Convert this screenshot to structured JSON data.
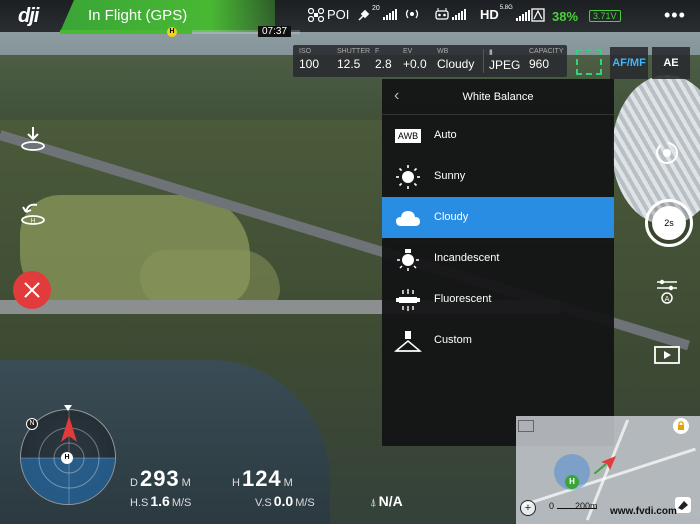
{
  "topbar": {
    "logo": "dji",
    "status": "In Flight (GPS)",
    "poi_label": "POI",
    "gps_count": "20",
    "hd_label": "HD",
    "hd_band": "5.8G",
    "battery_percent": "38%",
    "battery_voltage": "3.71V",
    "flight_time": "07:37",
    "home_marker": "H",
    "flight_progress": 0.55,
    "status_color": "#49b833"
  },
  "camera": {
    "params": [
      {
        "label": "ISO",
        "value": "100"
      },
      {
        "label": "SHUTTER",
        "value": "12.5"
      },
      {
        "label": "F",
        "value": "2.8"
      },
      {
        "label": "EV",
        "value": "+0.0"
      },
      {
        "label": "WB",
        "value": "Cloudy"
      },
      {
        "label": "",
        "value": "JPEG"
      },
      {
        "label": "CAPACITY",
        "value": "960"
      }
    ],
    "afmf_label": "AF/MF",
    "ae_label": "AE",
    "accent_color": "#3fb6ff"
  },
  "white_balance": {
    "title": "White Balance",
    "options": [
      {
        "label": "Auto",
        "icon": "awb-icon",
        "icon_text": "AWB",
        "selected": false
      },
      {
        "label": "Sunny",
        "icon": "sun-icon",
        "selected": false
      },
      {
        "label": "Cloudy",
        "icon": "cloud-icon",
        "selected": true
      },
      {
        "label": "Incandescent",
        "icon": "bulb-icon",
        "selected": false
      },
      {
        "label": "Fluorescent",
        "icon": "fluorescent-icon",
        "selected": false
      },
      {
        "label": "Custom",
        "icon": "custom-wb-icon",
        "selected": false
      }
    ],
    "selected_color": "#2a8de4"
  },
  "shutter": {
    "label": "2s"
  },
  "radar": {
    "north": "N",
    "home": "H"
  },
  "telemetry": {
    "distance_key": "D",
    "distance_value": "293",
    "distance_unit": "M",
    "height_key": "H",
    "height_value": "124",
    "height_unit": "M",
    "hspeed_key": "H.S",
    "hspeed_value": "1.6",
    "hspeed_unit": "M/S",
    "vspeed_key": "V.S",
    "vspeed_value": "0.0",
    "vspeed_unit": "M/S",
    "vps_value": "N/A"
  },
  "minimap": {
    "scale_start": "0",
    "scale_end": "200m",
    "home": "H",
    "watermark": "www.fvdi.com"
  }
}
